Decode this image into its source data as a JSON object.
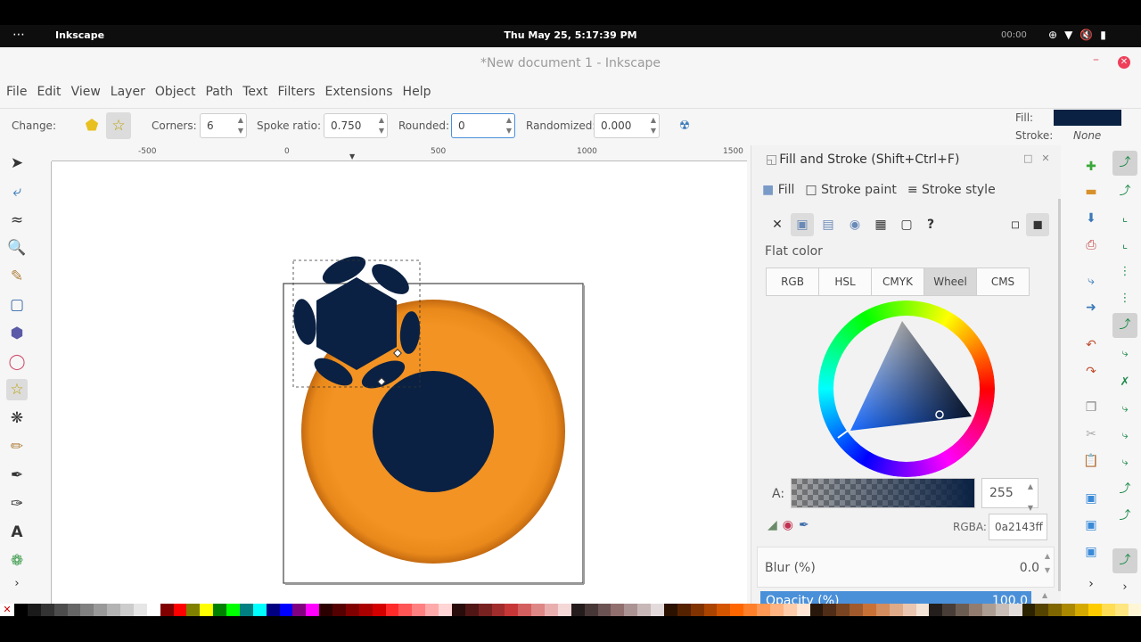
{
  "topbar": {
    "activities": "⋯",
    "app_name": "Inkscape",
    "clock": "Thu May 25,  5:17:39 PM",
    "record_time": "00:00"
  },
  "window": {
    "title": "*New document 1 - Inkscape",
    "minimize": "–",
    "close": "✕"
  },
  "menu": [
    "File",
    "Edit",
    "View",
    "Layer",
    "Object",
    "Path",
    "Text",
    "Filters",
    "Extensions",
    "Help"
  ],
  "tool_controls": {
    "change_label": "Change:",
    "corners_label": "Corners:",
    "corners_value": "6",
    "spoke_label": "Spoke ratio:",
    "spoke_value": "0.750",
    "rounded_label": "Rounded:",
    "rounded_value": "0",
    "randomized_label": "Randomized:",
    "randomized_value": "0.000",
    "fill_label": "Fill:",
    "fill_color": "#0a2143",
    "stroke_label": "Stroke:",
    "stroke_value": "None"
  },
  "ruler": {
    "ticks": [
      "-500",
      "0",
      "500",
      "1000",
      "1500"
    ]
  },
  "dock": {
    "title": "Fill and Stroke (Shift+Ctrl+F)",
    "tabs": [
      "Fill",
      "Stroke paint",
      "Stroke style"
    ],
    "paint_none": "✕",
    "paint_unset": "?",
    "flat_color": "Flat color",
    "modes": [
      "RGB",
      "HSL",
      "CMYK",
      "Wheel",
      "CMS"
    ],
    "selected_mode": "Wheel",
    "alpha_label": "A:",
    "alpha_value": "255",
    "rgba_label": "RGBA:",
    "rgba_value": "0a2143ff",
    "blur_label": "Blur (%)",
    "blur_value": "0.0",
    "opacity_label": "Opacity (%)",
    "opacity_value": "100.0"
  },
  "colors": {
    "accent": "#4a90d9",
    "object_fill": "#0a2143",
    "orange": "#f39323"
  },
  "palette": [
    "#000000",
    "#1a1a1a",
    "#333333",
    "#4d4d4d",
    "#666666",
    "#808080",
    "#999999",
    "#b3b3b3",
    "#cccccc",
    "#e6e6e6",
    "#ffffff",
    "#800000",
    "#ff0000",
    "#808000",
    "#ffff00",
    "#008000",
    "#00ff00",
    "#008080",
    "#00ffff",
    "#000080",
    "#0000ff",
    "#800080",
    "#ff00ff",
    "#2b0000",
    "#550000",
    "#800000",
    "#aa0000",
    "#d40000",
    "#ff2a2a",
    "#ff5555",
    "#ff8080",
    "#ffaaaa",
    "#ffd5d5",
    "#280b0b",
    "#501616",
    "#782121",
    "#a02c2c",
    "#c83737",
    "#d35f5f",
    "#de8787",
    "#e9afaf",
    "#f4d7d7",
    "#241c1c",
    "#483737",
    "#6c5353",
    "#916f6f",
    "#ac9393",
    "#c8b7b7",
    "#e3dbdb",
    "#2b1100",
    "#552200",
    "#803300",
    "#aa4400",
    "#d45500",
    "#ff6600",
    "#ff7f2a",
    "#ff9955",
    "#ffb380",
    "#ffccaa",
    "#ffe6d5",
    "#28170b",
    "#502d16",
    "#784421",
    "#a05a2c",
    "#c87137",
    "#d38d5f",
    "#deaa87",
    "#e9c6af",
    "#f4e3d7",
    "#241f1c",
    "#483e37",
    "#6c5d53",
    "#917c6f",
    "#ac9d93",
    "#c8beb7",
    "#e3dedb",
    "#2b2200",
    "#554400",
    "#806600",
    "#aa8800",
    "#d4aa00",
    "#ffcc00",
    "#ffdd55",
    "#ffe680",
    "#fff6d5"
  ]
}
